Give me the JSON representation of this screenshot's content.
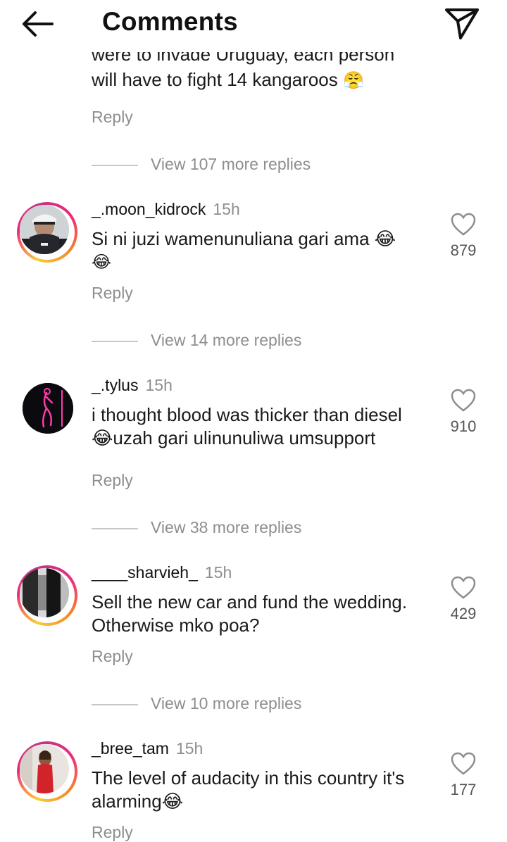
{
  "header": {
    "title": "Comments",
    "back_icon": "arrow-left-icon",
    "send_icon": "paper-plane-icon"
  },
  "prev_comment": {
    "line1": "were to invade Uruguay, each person",
    "line2_text": "will have to fight 14 kangaroos",
    "line2_emoji": "😤",
    "reply_label": "Reply"
  },
  "comments": [
    {
      "username": "_.moon_kidrock",
      "time": "15h",
      "line1": "Si ni juzi wamenunuliana gari ama 😂",
      "line2": "😂",
      "likes": "879",
      "reply_label": "Reply",
      "view_more": "View 14 more replies"
    },
    {
      "username": "_.tylus",
      "time": "15h",
      "line1": "i thought blood was thicker than diesel",
      "line2": "😂uzah gari ulinunuliwa umsupport",
      "likes": "910",
      "reply_label": "Reply",
      "view_more": "View 38 more replies"
    },
    {
      "username": "____sharvieh_",
      "time": "15h",
      "line1": "Sell the new car and fund the wedding.",
      "line2": "Otherwise mko poa?",
      "likes": "429",
      "reply_label": "Reply",
      "view_more": "View 10 more replies"
    },
    {
      "username": "_bree_tam",
      "time": "15h",
      "line1": "The level of audacity in this country it's",
      "line2": "alarming😂",
      "likes": "177",
      "reply_label": "Reply"
    }
  ],
  "first_view_more": "View 107 more replies",
  "colors": {
    "secondary_text": "#8e8e8e",
    "story_ring": [
      "#f9ce34",
      "#ee2a7b",
      "#c13584"
    ]
  }
}
